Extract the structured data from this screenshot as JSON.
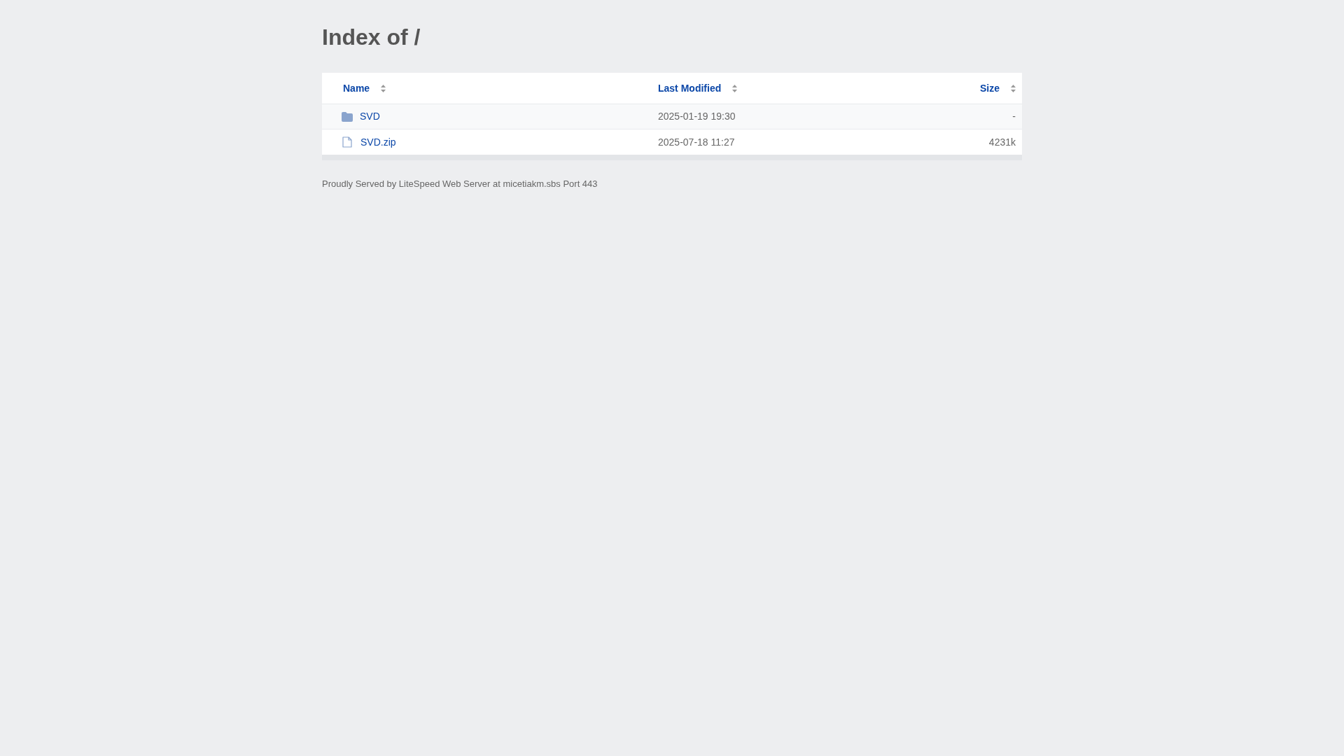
{
  "title": "Index of /",
  "table": {
    "columns": [
      {
        "label": "Name"
      },
      {
        "label": "Last Modified"
      },
      {
        "label": "Size"
      }
    ],
    "rows": [
      {
        "kind": "folder",
        "name": "SVD",
        "modified": "2025-01-19 19:30",
        "size": "-"
      },
      {
        "kind": "file",
        "name": "SVD.zip",
        "modified": "2025-07-18 11:27",
        "size": "4231k"
      }
    ]
  },
  "footer": "Proudly Served by LiteSpeed Web Server at micetiakm.sbs Port 443"
}
